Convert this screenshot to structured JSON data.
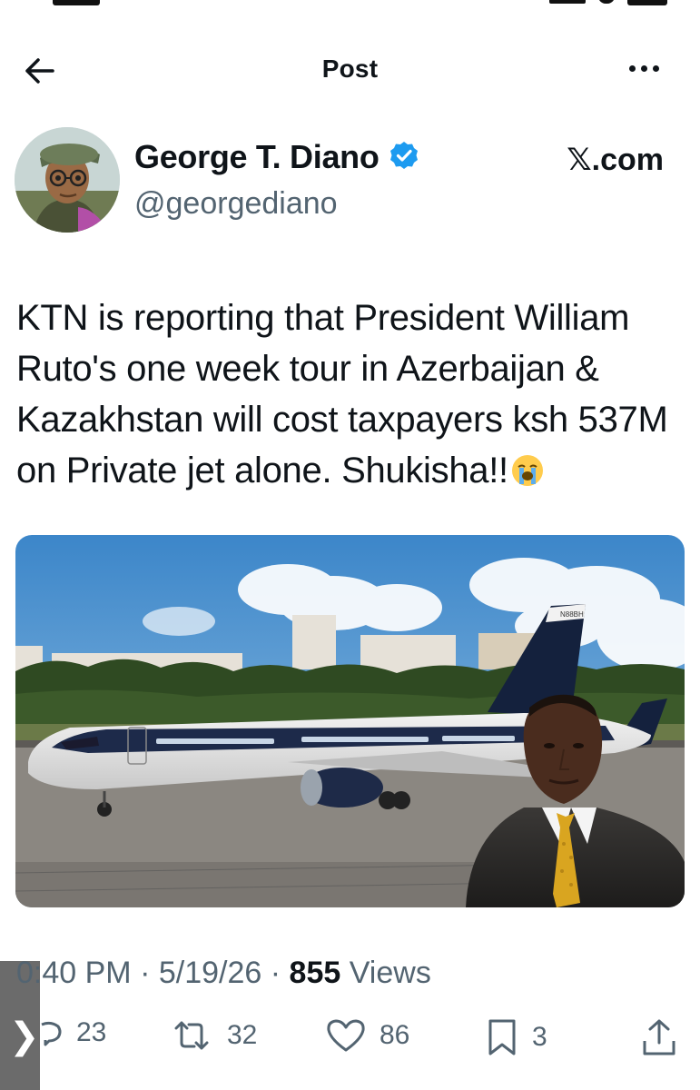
{
  "header": {
    "title": "Post"
  },
  "author": {
    "name": "George T. Diano",
    "handle": "@georgediano",
    "verified": true,
    "source": "𝕏.com"
  },
  "tweet": {
    "text": "KTN is reporting that President William Ruto's one week tour in Azerbaijan & Kazakhstan will cost taxpayers ksh 537M on Private jet alone. Shukisha!!",
    "emoji": "loudly-crying-face"
  },
  "media": {
    "tail_text": "N88BH",
    "description_icon": "jet-photo"
  },
  "meta": {
    "time": "0:40 PM",
    "sep1": "·",
    "date": "5/19/26",
    "sep2": "·",
    "views_count": "855",
    "views_label": "Views"
  },
  "actions": {
    "replies": "23",
    "reposts": "32",
    "likes": "86",
    "bookmarks": "3"
  },
  "side_tab": {
    "label": "❯"
  },
  "colors": {
    "text": "#0f1419",
    "secondary": "#536471",
    "verified": "#1d9bf0"
  }
}
